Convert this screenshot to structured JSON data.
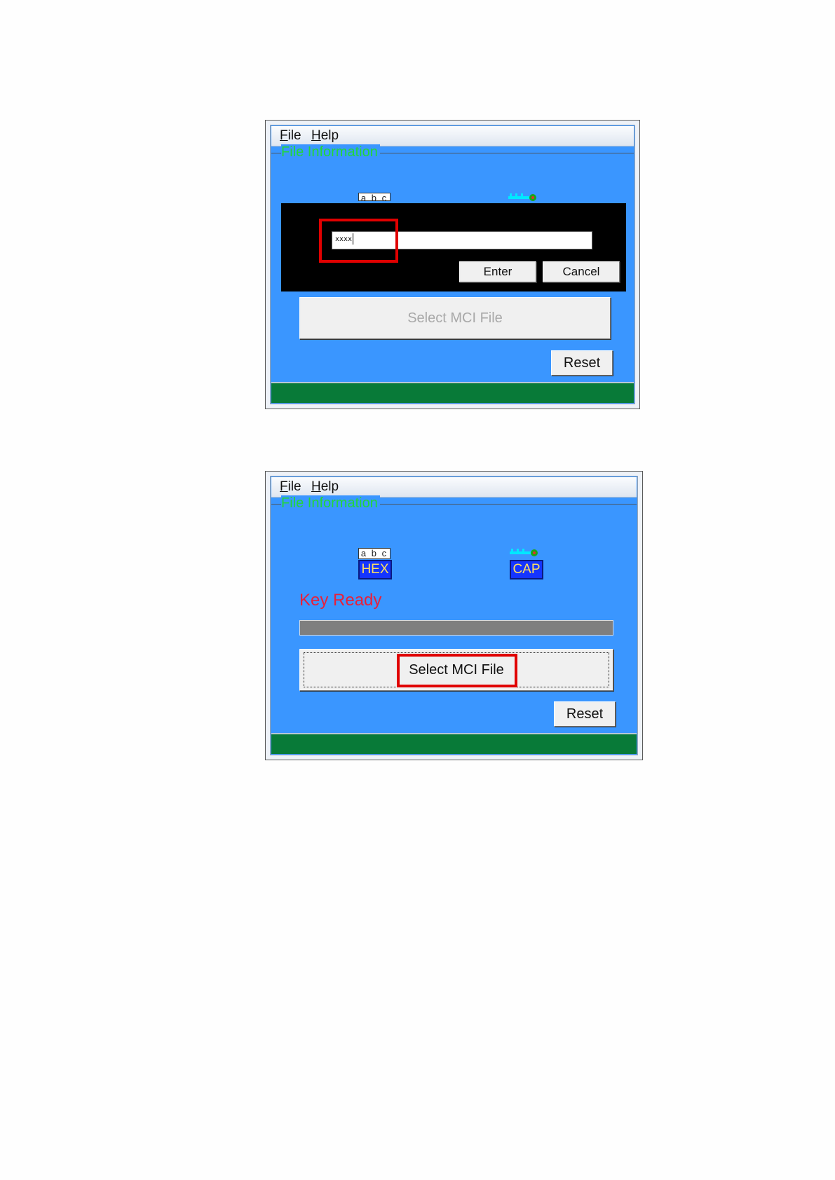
{
  "window1": {
    "menu": {
      "file": "File",
      "help": "Help"
    },
    "group_title": "File Information",
    "abc_label": "a b c",
    "dialog": {
      "password_value": "xxxx",
      "enter_button": "Enter",
      "cancel_button": "Cancel"
    },
    "select_button": "Select MCI File",
    "reset_button": "Reset"
  },
  "window2": {
    "menu": {
      "file": "File",
      "help": "Help"
    },
    "group_title": "File Information",
    "abc_label": "a b c",
    "hex_badge": "HEX",
    "cap_badge": "CAP",
    "status_text": "Key Ready",
    "select_button": "Select MCI File",
    "reset_button": "Reset"
  },
  "colors": {
    "window_bg": "#3a96ff",
    "status_bar": "#087a38",
    "highlight": "#e00000",
    "group_title": "#22d63a",
    "status_text": "#e8203a"
  },
  "icons": [
    "key-icon"
  ]
}
